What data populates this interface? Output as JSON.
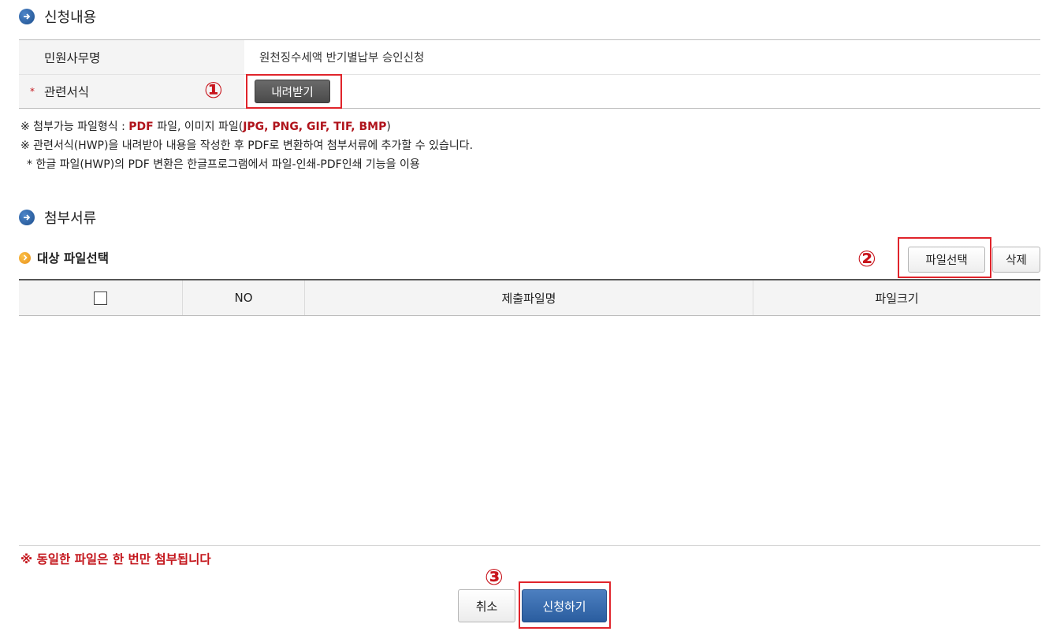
{
  "section1": {
    "title": "신청내용",
    "rows": [
      {
        "label": "민원사무명",
        "value": "원천징수세액 반기별납부 승인신청"
      },
      {
        "label": "관련서식",
        "required_mark": "*",
        "button": "내려받기"
      }
    ]
  },
  "notes": {
    "line1_prefix": "※ 첨부가능 파일형식 : ",
    "line1_pdf": "PDF",
    "line1_mid": " 파일, 이미지 파일(",
    "line1_formats": "JPG, PNG, GIF, TIF, BMP",
    "line1_suffix": ")",
    "line2": "※ 관련서식(HWP)을 내려받아 내용을 작성한 후 PDF로 변환하여 첨부서류에 추가할 수 있습니다.",
    "line3": "* 한글 파일(HWP)의 PDF 변환은 한글프로그램에서 파일-인쇄-PDF인쇄 기능을 이용"
  },
  "section2": {
    "title": "첨부서류",
    "subtitle": "대상 파일선택",
    "buttons": {
      "select_file": "파일선택",
      "delete": "삭제"
    },
    "table": {
      "columns": [
        "",
        "NO",
        "제출파일명",
        "파일크기"
      ],
      "rows": []
    }
  },
  "warning": "※ 동일한 파일은 한 번만 첨부됩니다",
  "actions": {
    "cancel": "취소",
    "submit": "신청하기"
  },
  "annotations": [
    "①",
    "②",
    "③"
  ],
  "colors": {
    "accent_blue": "#2a5d9f",
    "highlight_red": "#e0242b",
    "note_red": "#b0141c"
  }
}
